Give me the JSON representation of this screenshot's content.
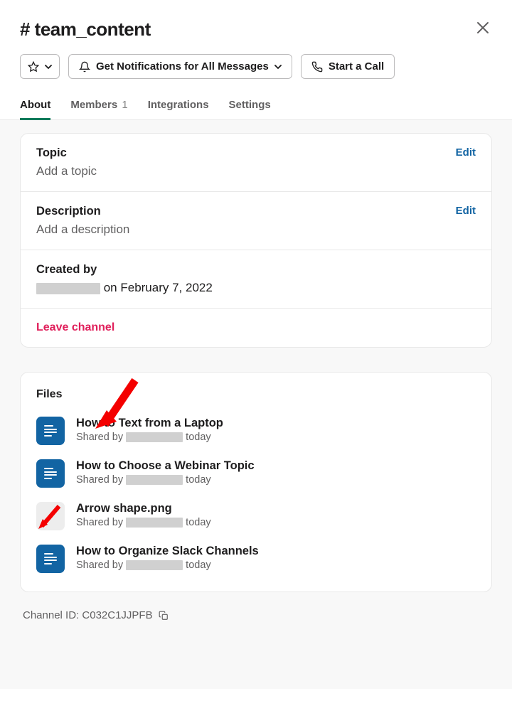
{
  "header": {
    "channel_name": "# team_content"
  },
  "toolbar": {
    "notifications_label": "Get Notifications for All Messages",
    "call_label": "Start a Call"
  },
  "tabs": {
    "about": "About",
    "members": "Members",
    "members_count": "1",
    "integrations": "Integrations",
    "settings": "Settings"
  },
  "about": {
    "topic_label": "Topic",
    "topic_placeholder": "Add a topic",
    "description_label": "Description",
    "description_placeholder": "Add a description",
    "edit_label": "Edit",
    "created_label": "Created by",
    "created_suffix": " on February 7, 2022",
    "leave_label": "Leave channel"
  },
  "files": {
    "section_label": "Files",
    "shared_prefix": "Shared by ",
    "shared_suffix": "today",
    "items": [
      {
        "name": "How to Text from a Laptop",
        "type": "doc"
      },
      {
        "name": "How to Choose a Webinar Topic",
        "type": "doc"
      },
      {
        "name": "Arrow shape.png",
        "type": "img"
      },
      {
        "name": "How to Organize Slack Channels",
        "type": "doc"
      }
    ]
  },
  "footer": {
    "channel_id_label": "Channel ID: ",
    "channel_id": "C032C1JJPFB"
  }
}
